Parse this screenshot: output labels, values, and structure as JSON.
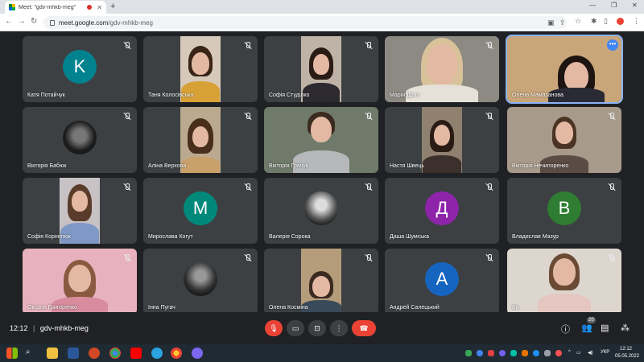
{
  "browser": {
    "tab_title": "Meet: \"gdv-mhkb-meg\"",
    "url_host": "meet.google.com",
    "url_path": "/gdv-mhkb-meg"
  },
  "participants": [
    {
      "name": "Катя Потайчук",
      "initial": "K",
      "avatar_color": "#00838f"
    },
    {
      "name": "Таня Колосівська"
    },
    {
      "name": "Софія Студілко"
    },
    {
      "name": "Марія Драч"
    },
    {
      "name": "Олена Мамазанова"
    },
    {
      "name": "Вікторія Бабюк"
    },
    {
      "name": "Аліна Верхова"
    },
    {
      "name": "Вікторія Грачук"
    },
    {
      "name": "Настя Швець"
    },
    {
      "name": "Вікторія Нечипоренко"
    },
    {
      "name": "Софія Корнелюк"
    },
    {
      "name": "Мирослава Когут",
      "initial": "М",
      "avatar_color": "#00897b"
    },
    {
      "name": "Валерія Сорока"
    },
    {
      "name": "Даша Шумська",
      "initial": "Д",
      "avatar_color": "#8e24aa"
    },
    {
      "name": "Владислав Мазур",
      "initial": "В",
      "avatar_color": "#2e7d32"
    },
    {
      "name": "Оксана Григоренко"
    },
    {
      "name": "Інна Пугач"
    },
    {
      "name": "Олена Косміна"
    },
    {
      "name": "Андрей Салецький",
      "initial": "А",
      "avatar_color": "#1565c0"
    },
    {
      "name": "Ви"
    }
  ],
  "meeting": {
    "time": "12:12",
    "separator": "|",
    "code": "gdv-mhkb-meg",
    "participant_count": "20"
  },
  "taskbar": {
    "language": "УКР",
    "time": "12:12",
    "date": "05.05.2022"
  }
}
